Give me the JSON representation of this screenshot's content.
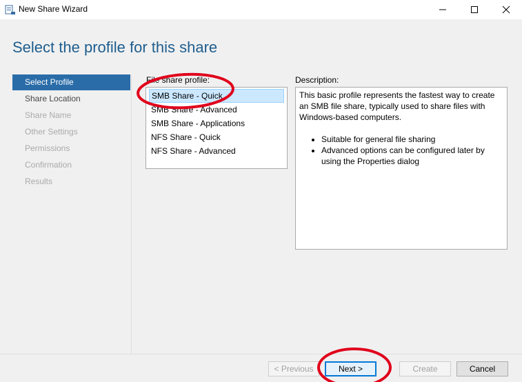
{
  "window": {
    "title": "New Share Wizard",
    "icon": "share-wizard-icon",
    "controls": [
      "minimize-icon",
      "maximize-icon",
      "close-icon"
    ]
  },
  "page": {
    "title": "Select the profile for this share"
  },
  "steps": [
    {
      "label": "Select Profile",
      "state": "current"
    },
    {
      "label": "Share Location",
      "state": "enabled"
    },
    {
      "label": "Share Name",
      "state": "disabled"
    },
    {
      "label": "Other Settings",
      "state": "disabled"
    },
    {
      "label": "Permissions",
      "state": "disabled"
    },
    {
      "label": "Confirmation",
      "state": "disabled"
    },
    {
      "label": "Results",
      "state": "disabled"
    }
  ],
  "profiles": {
    "label": "File share profile:",
    "items": [
      "SMB Share - Quick",
      "SMB Share - Advanced",
      "SMB Share - Applications",
      "NFS Share - Quick",
      "NFS Share - Advanced"
    ],
    "selected": "SMB Share - Quick"
  },
  "description": {
    "label": "Description:",
    "text": "This basic profile represents the fastest way to create an SMB file share, typically used to share files with Windows-based computers.",
    "bullets": [
      "Suitable for general file sharing",
      "Advanced options can be configured later by using the Properties dialog"
    ]
  },
  "buttons": {
    "previous": "< Previous",
    "next": "Next >",
    "create": "Create",
    "cancel": "Cancel"
  },
  "colors": {
    "accent": "#2a6ca8",
    "title": "#1e5d8e",
    "selection": "#cce8ff",
    "annotation": "#e0001b"
  }
}
